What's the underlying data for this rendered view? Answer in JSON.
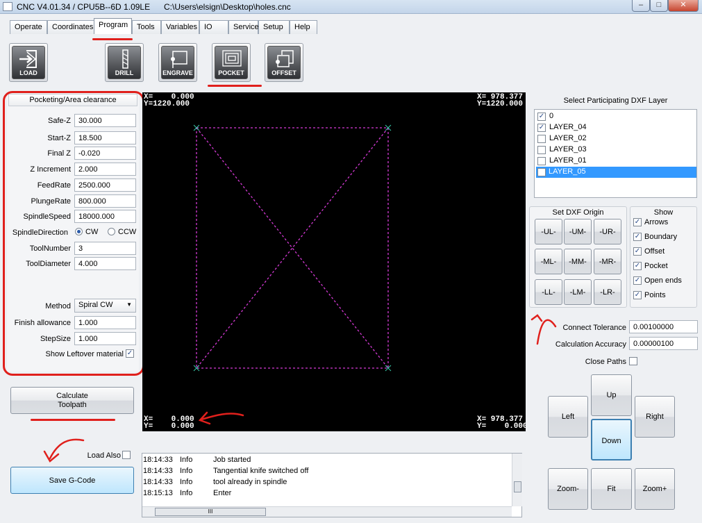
{
  "window": {
    "title": "CNC V4.01.34 / CPU5B--6D 1.09LE",
    "file_path": "C:\\Users\\elsign\\Desktop\\holes.cnc",
    "min_glyph": "–",
    "max_glyph": "□",
    "close_glyph": "✕"
  },
  "tabs": [
    "Operate",
    "Coordinates",
    "Program",
    "Tools",
    "Variables",
    "IO",
    "Service",
    "Setup",
    "Help"
  ],
  "active_tab": "Program",
  "toolbar": {
    "load": "LOAD",
    "drill": "DRILL",
    "engrave": "ENGRAVE",
    "pocket": "POCKET",
    "offset": "OFFSET"
  },
  "params": {
    "title": "Pocketing/Area clearance",
    "safe_z": {
      "label": "Safe-Z",
      "value": "30.000"
    },
    "start_z": {
      "label": "Start-Z",
      "value": "18.500"
    },
    "final_z": {
      "label": "Final Z",
      "value": "-0.020"
    },
    "z_increment": {
      "label": "Z Increment",
      "value": "2.000"
    },
    "feedrate": {
      "label": "FeedRate",
      "value": "2500.000"
    },
    "plungerate": {
      "label": "PlungeRate",
      "value": "800.000"
    },
    "spindlespeed": {
      "label": "SpindleSpeed",
      "value": "18000.000"
    },
    "spindle_direction": {
      "label": "SpindleDirection",
      "cw": "CW",
      "ccw": "CCW",
      "selected": "CW"
    },
    "tool_number": {
      "label": "ToolNumber",
      "value": "3"
    },
    "tool_diameter": {
      "label": "ToolDiameter",
      "value": "4.000"
    },
    "method": {
      "label": "Method",
      "value": "Spiral CW"
    },
    "finish_allowance": {
      "label": "Finish allowance",
      "value": "1.000"
    },
    "stepsize": {
      "label": "StepSize",
      "value": "1.000"
    },
    "show_leftover": {
      "label": "Show Leftover material",
      "checked": true
    }
  },
  "calculate_button": {
    "line1": "Calculate",
    "line2": "Toolpath"
  },
  "load_also": {
    "label": "Load Also",
    "checked": false
  },
  "save_gcode": "Save G-Code",
  "canvas": {
    "top_left": "X=    0.000\nY=1220.000",
    "top_right": "X= 978.377\nY=1220.000",
    "bottom_left": "X=    0.000\nY=    0.000",
    "bottom_right": "X= 978.377\nY=    0.000"
  },
  "log": [
    {
      "time": "18:14:33",
      "level": "Info",
      "message": "Job started"
    },
    {
      "time": "18:14:33",
      "level": "Info",
      "message": "Tangential knife switched off"
    },
    {
      "time": "18:14:33",
      "level": "Info",
      "message": "tool already in spindle"
    },
    {
      "time": "18:15:13",
      "level": "Info",
      "message": "Enter"
    }
  ],
  "log_scroll_thumb": "III",
  "layers": {
    "title": "Select Participating DXF Layer",
    "items": [
      {
        "name": "0",
        "checked": true
      },
      {
        "name": "LAYER_04",
        "checked": true
      },
      {
        "name": "LAYER_02",
        "checked": false
      },
      {
        "name": "LAYER_03",
        "checked": false
      },
      {
        "name": "LAYER_01",
        "checked": false
      },
      {
        "name": "LAYER_05",
        "checked": false,
        "selected": true
      }
    ]
  },
  "origin": {
    "title": "Set DXF Origin",
    "buttons": [
      "-UL-",
      "-UM-",
      "-UR-",
      "-ML-",
      "-MM-",
      "-MR-",
      "-LL-",
      "-LM-",
      "-LR-"
    ]
  },
  "show": {
    "title": "Show",
    "items": [
      {
        "name": "Arrows",
        "checked": true
      },
      {
        "name": "Boundary",
        "checked": true
      },
      {
        "name": "Offset",
        "checked": true
      },
      {
        "name": "Pocket",
        "checked": true
      },
      {
        "name": "Open ends",
        "checked": true
      },
      {
        "name": "Points",
        "checked": true
      }
    ]
  },
  "connect_tolerance": {
    "label": "Connect Tolerance",
    "value": "0.00100000"
  },
  "calc_accuracy": {
    "label": "Calculation Accuracy",
    "value": "0.00000100"
  },
  "close_paths": {
    "label": "Close Paths",
    "checked": false
  },
  "nav": {
    "up": "Up",
    "left": "Left",
    "right": "Right",
    "down": "Down",
    "zoom_minus": "Zoom-",
    "fit": "Fit",
    "zoom_plus": "Zoom+"
  },
  "check_glyph": "✓",
  "dropdown_glyph": "▼",
  "colors": {
    "annotation": "#e0201c",
    "path": "#d63ad6",
    "canvas": "#000000",
    "selection": "#3399ff"
  }
}
